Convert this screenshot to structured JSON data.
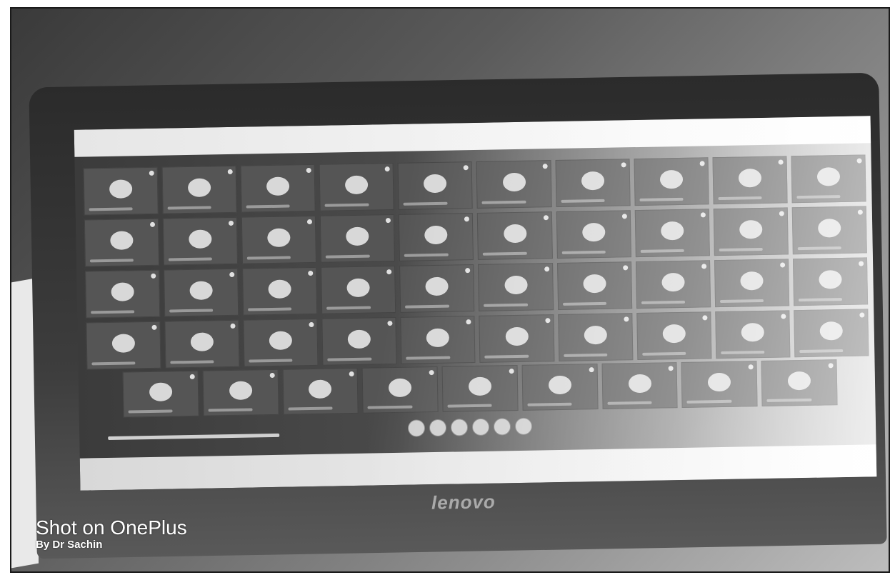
{
  "monitor": {
    "brand": "lenovo"
  },
  "watermark": {
    "title": "Shot on OnePlus",
    "subtitle": "By Dr Sachin"
  },
  "meeting": {
    "grid_rows": 4,
    "grid_columns": 10,
    "last_row_tiles": 9,
    "control_buttons": 6
  }
}
